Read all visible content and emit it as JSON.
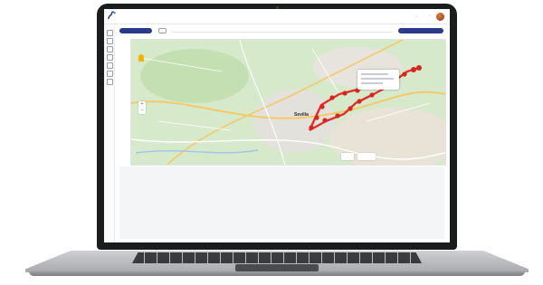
{
  "app": {
    "title": "",
    "logo": "route-logo-icon",
    "accent_color": "#2b3a8c"
  },
  "toolbar": {
    "filter_pill": "",
    "label": "",
    "action_pill": ""
  },
  "map": {
    "city_label": "Sevilla",
    "route_color": "#e0302b",
    "zoom_in": "+",
    "zoom_out": "−"
  }
}
